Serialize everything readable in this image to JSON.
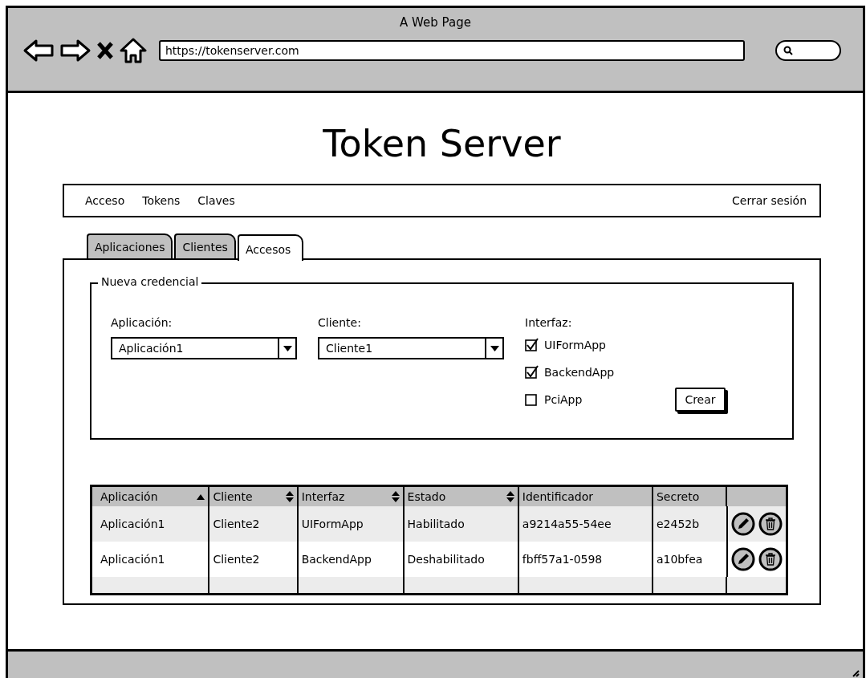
{
  "browser": {
    "title": "A Web Page",
    "url": "https://tokenserver.com"
  },
  "page_title": "Token Server",
  "nav": {
    "items": [
      "Acceso",
      "Tokens",
      "Claves"
    ],
    "logout": "Cerrar sesión"
  },
  "tabs": [
    {
      "label": "Aplicaciones",
      "selected": false
    },
    {
      "label": "Clientes",
      "selected": false
    },
    {
      "label": "Accesos",
      "selected": true
    }
  ],
  "form": {
    "legend": "Nueva credencial",
    "application": {
      "label": "Aplicación:",
      "value": "Aplicación1"
    },
    "client": {
      "label": "Cliente:",
      "value": "Cliente1"
    },
    "interface": {
      "label": "Interfaz:",
      "options": [
        {
          "label": "UIFormApp",
          "checked": true
        },
        {
          "label": "BackendApp",
          "checked": true
        },
        {
          "label": "PciApp",
          "checked": false
        }
      ]
    },
    "create_button": "Crear"
  },
  "table": {
    "columns": [
      {
        "label": "Aplicación",
        "kind": "sorted_ascending"
      },
      {
        "label": "Cliente",
        "kind": "sortable"
      },
      {
        "label": "Interfaz",
        "kind": "sortable"
      },
      {
        "label": "Estado",
        "kind": "sortable"
      },
      {
        "label": "Identificador",
        "kind": "plain"
      },
      {
        "label": "Secreto",
        "kind": "plain"
      }
    ],
    "rows": [
      [
        "Aplicación1",
        "Cliente2",
        "UIFormApp",
        "Habilitado",
        "a9214a55-54ee",
        "e2452b"
      ],
      [
        "Aplicación1",
        "Cliente2",
        "BackendApp",
        "Deshabilitado",
        "fbff57a1-0598",
        "a10bfea"
      ]
    ]
  }
}
